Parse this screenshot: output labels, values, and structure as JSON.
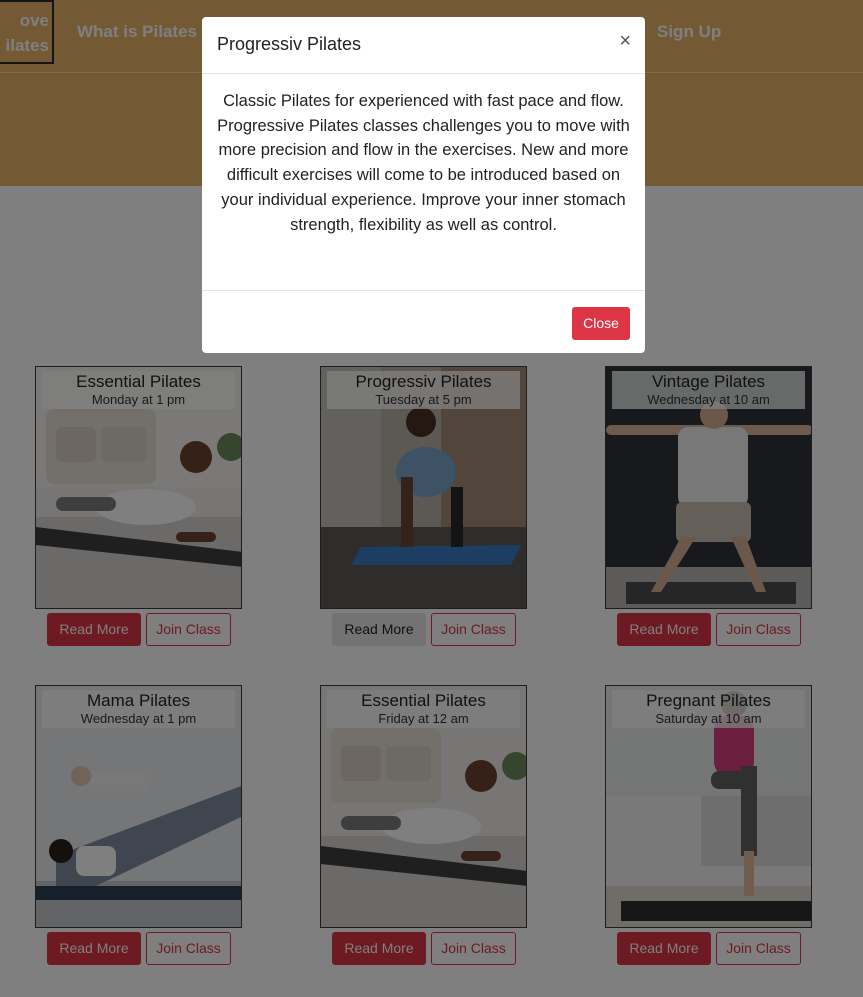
{
  "nav": {
    "brand_line1": "ove",
    "brand_line2": "ilates",
    "links": [
      "What is Pilates",
      "Sign Up"
    ]
  },
  "cards": [
    {
      "title": "Essential Pilates",
      "schedule": "Monday at 1 pm",
      "read_label": "Read More",
      "join_label": "Join Class",
      "photo": "man-planking-living-room"
    },
    {
      "title": "Progressiv Pilates",
      "schedule": "Tuesday at 5 pm",
      "read_label": "Read More",
      "join_label": "Join Class",
      "photo": "woman-push-up-mat"
    },
    {
      "title": "Vintage Pilates",
      "schedule": "Wednesday at 10 am",
      "read_label": "Read More",
      "join_label": "Join Class",
      "photo": "older-man-warrior-pose"
    },
    {
      "title": "Mama Pilates",
      "schedule": "Wednesday at 1 pm",
      "read_label": "Read More",
      "join_label": "Join Class",
      "photo": "mother-lifting-baby"
    },
    {
      "title": "Essential Pilates",
      "schedule": "Friday at 12 am",
      "read_label": "Read More",
      "join_label": "Join Class",
      "photo": "man-planking-living-room"
    },
    {
      "title": "Pregnant Pilates",
      "schedule": "Saturday at 10 am",
      "read_label": "Read More",
      "join_label": "Join Class",
      "photo": "pregnant-woman-stretching"
    }
  ],
  "modal": {
    "title": "Progressiv Pilates",
    "close_x": "×",
    "body": "Classic Pilates for experienced with fast pace and flow. Progressive Pilates classes challenges you to move with more precision and flow in the exercises. New and more difficult exercises will come to be introduced based on your individual experience. Improve your inner stomach strength, flexibility as well as control.",
    "close_label": "Close"
  },
  "colors": {
    "nav_bg": "#e8b569",
    "primary": "#dc3545",
    "overlay": "rgba(0,0,0,0.5)"
  }
}
